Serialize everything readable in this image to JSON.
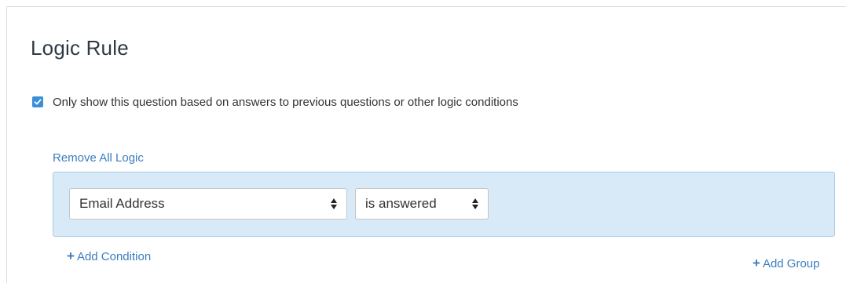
{
  "title": "Logic Rule",
  "checkbox": {
    "checked": true,
    "label": "Only show this question based on answers to previous questions or other logic conditions"
  },
  "remove_all_label": "Remove All Logic",
  "condition": {
    "field_value": "Email Address",
    "operator_value": "is answered"
  },
  "add_condition_label": "Add Condition",
  "add_group_label": "Add Group",
  "icons": {
    "add": "plus-icon",
    "select": "up-down-arrows-icon",
    "check": "checkmark-icon"
  },
  "colors": {
    "accent": "#3a8fd6",
    "link": "#3b7dbf",
    "group_bg": "#d8eaf7",
    "group_border": "#a9cbe5"
  }
}
